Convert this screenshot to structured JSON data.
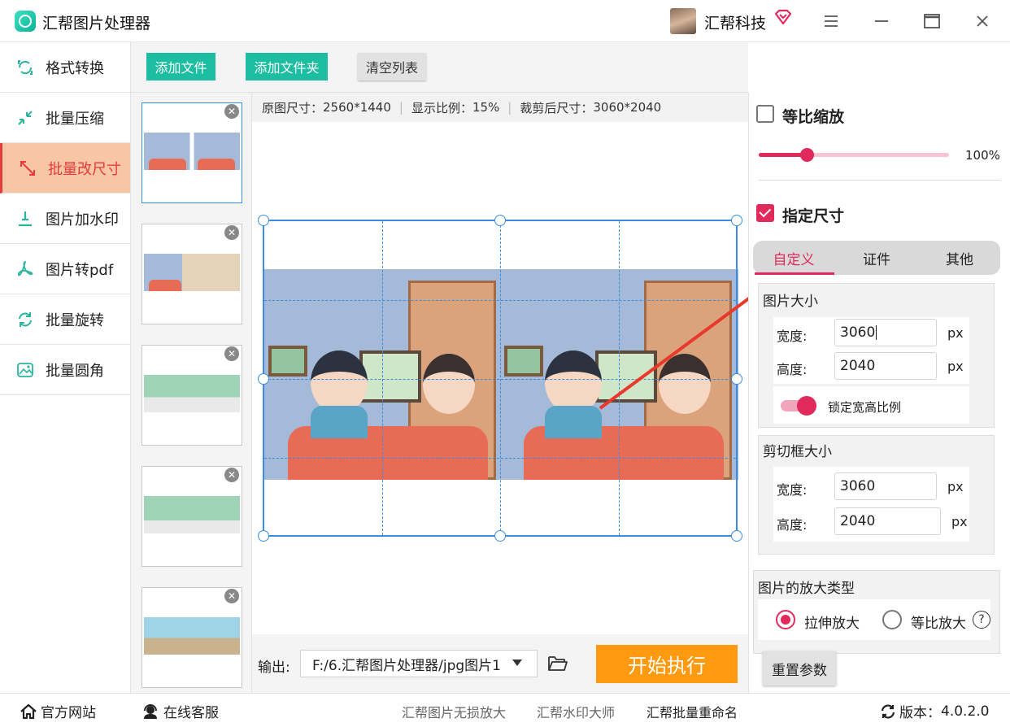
{
  "app": {
    "title": "汇帮图片处理器",
    "user_name": "汇帮科技",
    "accent": "#e02a5c",
    "teal": "#1dbda1",
    "orange": "#fe9a10"
  },
  "sidebar": {
    "items": [
      {
        "label": "格式转换",
        "icon": "convert-icon"
      },
      {
        "label": "批量压缩",
        "icon": "compress-icon"
      },
      {
        "label": "批量改尺寸",
        "icon": "resize-icon",
        "active": true
      },
      {
        "label": "图片加水印",
        "icon": "watermark-icon"
      },
      {
        "label": "图片转pdf",
        "icon": "pdf-icon"
      },
      {
        "label": "批量旋转",
        "icon": "rotate-icon"
      },
      {
        "label": "批量圆角",
        "icon": "rounded-corner-icon"
      }
    ]
  },
  "toolbar": {
    "add_file": "添加文件",
    "add_folder": "添加文件夹",
    "clear_list": "清空列表"
  },
  "info": {
    "original_size_label": "原图尺寸：",
    "original_size": "2560*1440",
    "display_ratio_label": "显示比例：",
    "display_ratio": "15%",
    "cropped_size_label": "裁剪后尺寸：",
    "cropped_size": "3060*2040"
  },
  "output": {
    "label": "输出:",
    "path": "F:/6.汇帮图片处理器/jpg图片1"
  },
  "start_button": "开始执行",
  "right_panel": {
    "proportional_scale_label": "等比缩放",
    "proportional_scale_checked": false,
    "scale_percent": 25,
    "scale_value": "100%",
    "specify_size_label": "指定尺寸",
    "specify_size_checked": true,
    "tabs": [
      "自定义",
      "证件",
      "其他"
    ],
    "active_tab": 0,
    "image_size": {
      "title": "图片大小",
      "width_label": "宽度:",
      "width": "3060",
      "height_label": "高度:",
      "height": "2040",
      "unit": "px",
      "lock_ratio_label": "锁定宽高比例",
      "lock_ratio_on": true
    },
    "crop_size": {
      "title": "剪切框大小",
      "width_label": "宽度:",
      "width": "3060",
      "height_label": "高度:",
      "height": "2040",
      "unit": "px"
    },
    "enlarge_type": {
      "title": "图片的放大类型",
      "options": [
        "拉伸放大",
        "等比放大"
      ],
      "selected": 0
    },
    "help_glyph": "?",
    "reset_button": "重置参数"
  },
  "statusbar": {
    "official_site": "官方网站",
    "online_service": "在线客服",
    "links": [
      "汇帮图片无损放大",
      "汇帮水印大师",
      "汇帮批量重命名"
    ],
    "version_label": "版本：",
    "version": "4.0.2.0"
  }
}
